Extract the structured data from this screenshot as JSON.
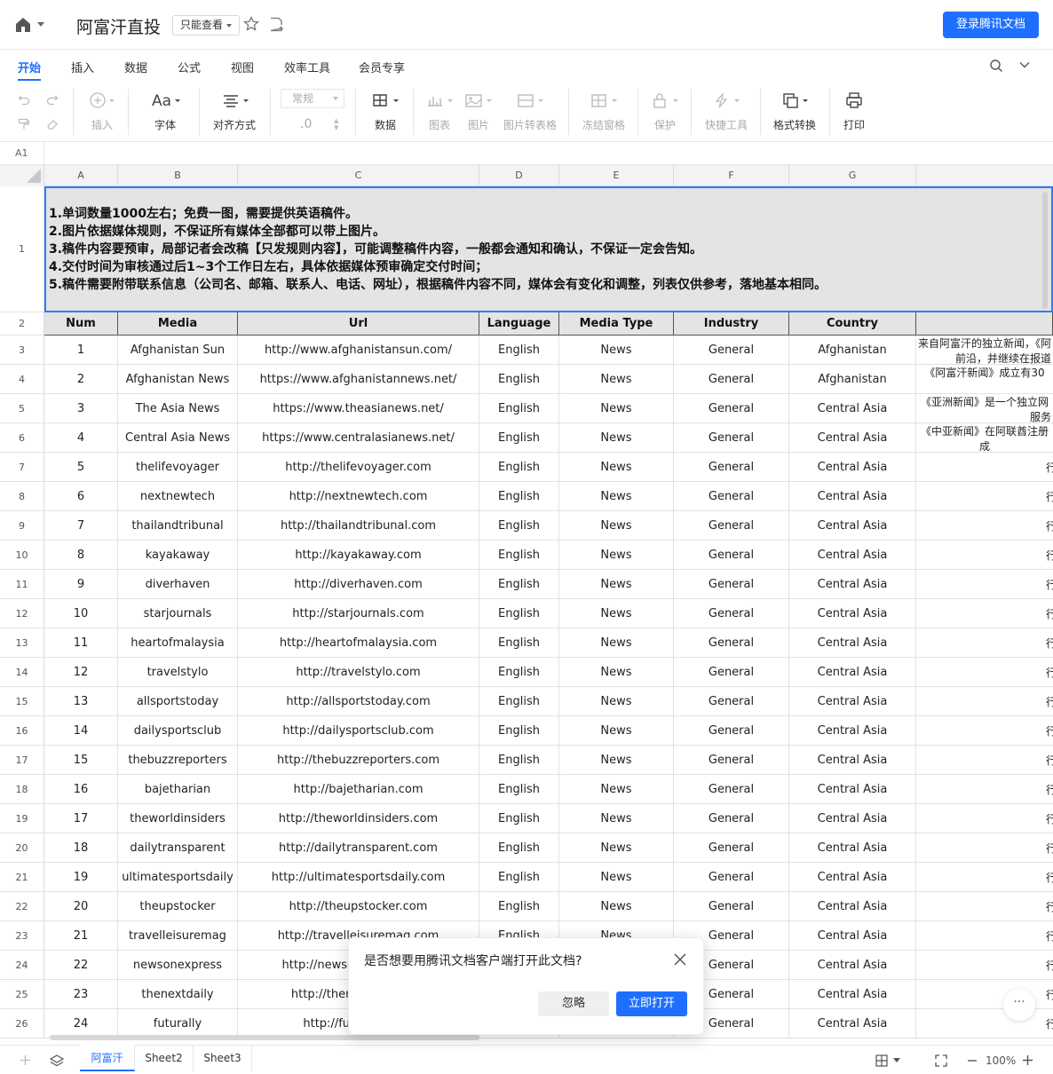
{
  "header": {
    "title": "阿富汗直投",
    "readonly_label": "只能查看",
    "login_button": "登录腾讯文档"
  },
  "menu": {
    "tabs": [
      "开始",
      "插入",
      "数据",
      "公式",
      "视图",
      "效率工具",
      "会员专享"
    ]
  },
  "toolbar": {
    "insert": "插入",
    "font": "字体",
    "align": "对齐方式",
    "number_format": "常规",
    "decimal": ".0",
    "data": "数据",
    "chart": "图表",
    "image": "图片",
    "image_to_table": "图片转表格",
    "freeze": "冻结窗格",
    "protect": "保护",
    "quick_tools": "快捷工具",
    "format_convert": "格式转换",
    "print": "打印"
  },
  "formula_bar": {
    "cell_ref": "A1"
  },
  "columns": [
    "A",
    "B",
    "C",
    "D",
    "E",
    "F",
    "G"
  ],
  "rows": [
    "1",
    "2",
    "3",
    "4",
    "5",
    "6",
    "7",
    "8",
    "9",
    "10",
    "11",
    "12",
    "13",
    "14",
    "15",
    "16",
    "17",
    "18",
    "19",
    "20",
    "21",
    "22",
    "23",
    "24",
    "25",
    "26"
  ],
  "notice_lines": [
    "1.单词数量1000左右；免费一图，需要提供英语稿件。",
    "2.图片依据媒体规则，不保证所有媒体全部都可以带上图片。",
    "3.稿件内容要预审，局部记者会改稿【只发规则内容】，可能调整稿件内容，一般都会通知和确认，不保证一定会告知。",
    "4.交付时间为审核通过后1~3个工作日左右，具体依据媒体预审确定交付时间；",
    "5.稿件需要附带联系信息（公司名、邮箱、联系人、电话、网址），根据稿件内容不同，媒体会有变化和调整，列表仅供参考，落地基本相同。"
  ],
  "table": {
    "headers": [
      "Num",
      "Media",
      "Url",
      "Language",
      "Media Type",
      "Industry",
      "Country"
    ],
    "rows": [
      [
        "1",
        "Afghanistan Sun",
        "http://www.afghanistansun.com/",
        "English",
        "News",
        "General",
        "Afghanistan",
        "来自阿富汗的独立新闻，《阿",
        "前沿，并继续在报道"
      ],
      [
        "2",
        "Afghanistan News",
        "https://www.afghanistannews.net/",
        "English",
        "News",
        "General",
        "Afghanistan",
        "《阿富汗新闻》成立有30",
        ""
      ],
      [
        "3",
        "The Asia News",
        "https://www.theasianews.net/",
        "English",
        "News",
        "General",
        "Central Asia",
        "《亚洲新闻》是一个独立网",
        "服务"
      ],
      [
        "4",
        "Central Asia News",
        "https://www.centralasianews.net/",
        "English",
        "News",
        "General",
        "Central Asia",
        "《中亚新闻》在阿联酋注册成",
        ""
      ],
      [
        "5",
        "thelifevoyager",
        "http://thelifevoyager.com",
        "English",
        "News",
        "General",
        "Central Asia",
        "行",
        ""
      ],
      [
        "6",
        "nextnewtech",
        "http://nextnewtech.com",
        "English",
        "News",
        "General",
        "Central Asia",
        "行",
        ""
      ],
      [
        "7",
        "thailandtribunal",
        "http://thailandtribunal.com",
        "English",
        "News",
        "General",
        "Central Asia",
        "行",
        ""
      ],
      [
        "8",
        "kayakaway",
        "http://kayakaway.com",
        "English",
        "News",
        "General",
        "Central Asia",
        "行",
        ""
      ],
      [
        "9",
        "diverhaven",
        "http://diverhaven.com",
        "English",
        "News",
        "General",
        "Central Asia",
        "行",
        ""
      ],
      [
        "10",
        "starjournals",
        "http://starjournals.com",
        "English",
        "News",
        "General",
        "Central Asia",
        "行",
        ""
      ],
      [
        "11",
        "heartofmalaysia",
        "http://heartofmalaysia.com",
        "English",
        "News",
        "General",
        "Central Asia",
        "行",
        ""
      ],
      [
        "12",
        "travelstylo",
        "http://travelstylo.com",
        "English",
        "News",
        "General",
        "Central Asia",
        "行",
        ""
      ],
      [
        "13",
        "allsportstoday",
        "http://allsportstoday.com",
        "English",
        "News",
        "General",
        "Central Asia",
        "行",
        ""
      ],
      [
        "14",
        "dailysportsclub",
        "http://dailysportsclub.com",
        "English",
        "News",
        "General",
        "Central Asia",
        "行",
        ""
      ],
      [
        "15",
        "thebuzzreporters",
        "http://thebuzzreporters.com",
        "English",
        "News",
        "General",
        "Central Asia",
        "行",
        ""
      ],
      [
        "16",
        "bajetharian",
        "http://bajetharian.com",
        "English",
        "News",
        "General",
        "Central Asia",
        "行",
        ""
      ],
      [
        "17",
        "theworldinsiders",
        "http://theworldinsiders.com",
        "English",
        "News",
        "General",
        "Central Asia",
        "行",
        ""
      ],
      [
        "18",
        "dailytransparent",
        "http://dailytransparent.com",
        "English",
        "News",
        "General",
        "Central Asia",
        "行",
        ""
      ],
      [
        "19",
        "ultimatesportsdaily",
        "http://ultimatesportsdaily.com",
        "English",
        "News",
        "General",
        "Central Asia",
        "行",
        ""
      ],
      [
        "20",
        "theupstocker",
        "http://theupstocker.com",
        "English",
        "News",
        "General",
        "Central Asia",
        "行",
        ""
      ],
      [
        "21",
        "travelleisuremag",
        "http://travelleisuremag.com",
        "English",
        "News",
        "General",
        "Central Asia",
        "行",
        ""
      ],
      [
        "22",
        "newsonexpress",
        "http://newsonexpress.com",
        "English",
        "News",
        "General",
        "Central Asia",
        "行",
        ""
      ],
      [
        "23",
        "thenextdaily",
        "http://thenextdaily.com",
        "English",
        "News",
        "General",
        "Central Asia",
        "行",
        ""
      ],
      [
        "24",
        "futurally",
        "http://futurally.com",
        "English",
        "News",
        "General",
        "Central Asia",
        "行",
        ""
      ]
    ]
  },
  "sheets": [
    "阿富汗",
    "Sheet2",
    "Sheet3"
  ],
  "zoom": "100%",
  "dialog": {
    "message": "是否想要用腾讯文档客户端打开此文档?",
    "ignore": "忽略",
    "open": "立即打开"
  },
  "colors": {
    "accent": "#1e6fff",
    "selection": "#2f7cf6",
    "header_fill": "#e4e4e4"
  }
}
